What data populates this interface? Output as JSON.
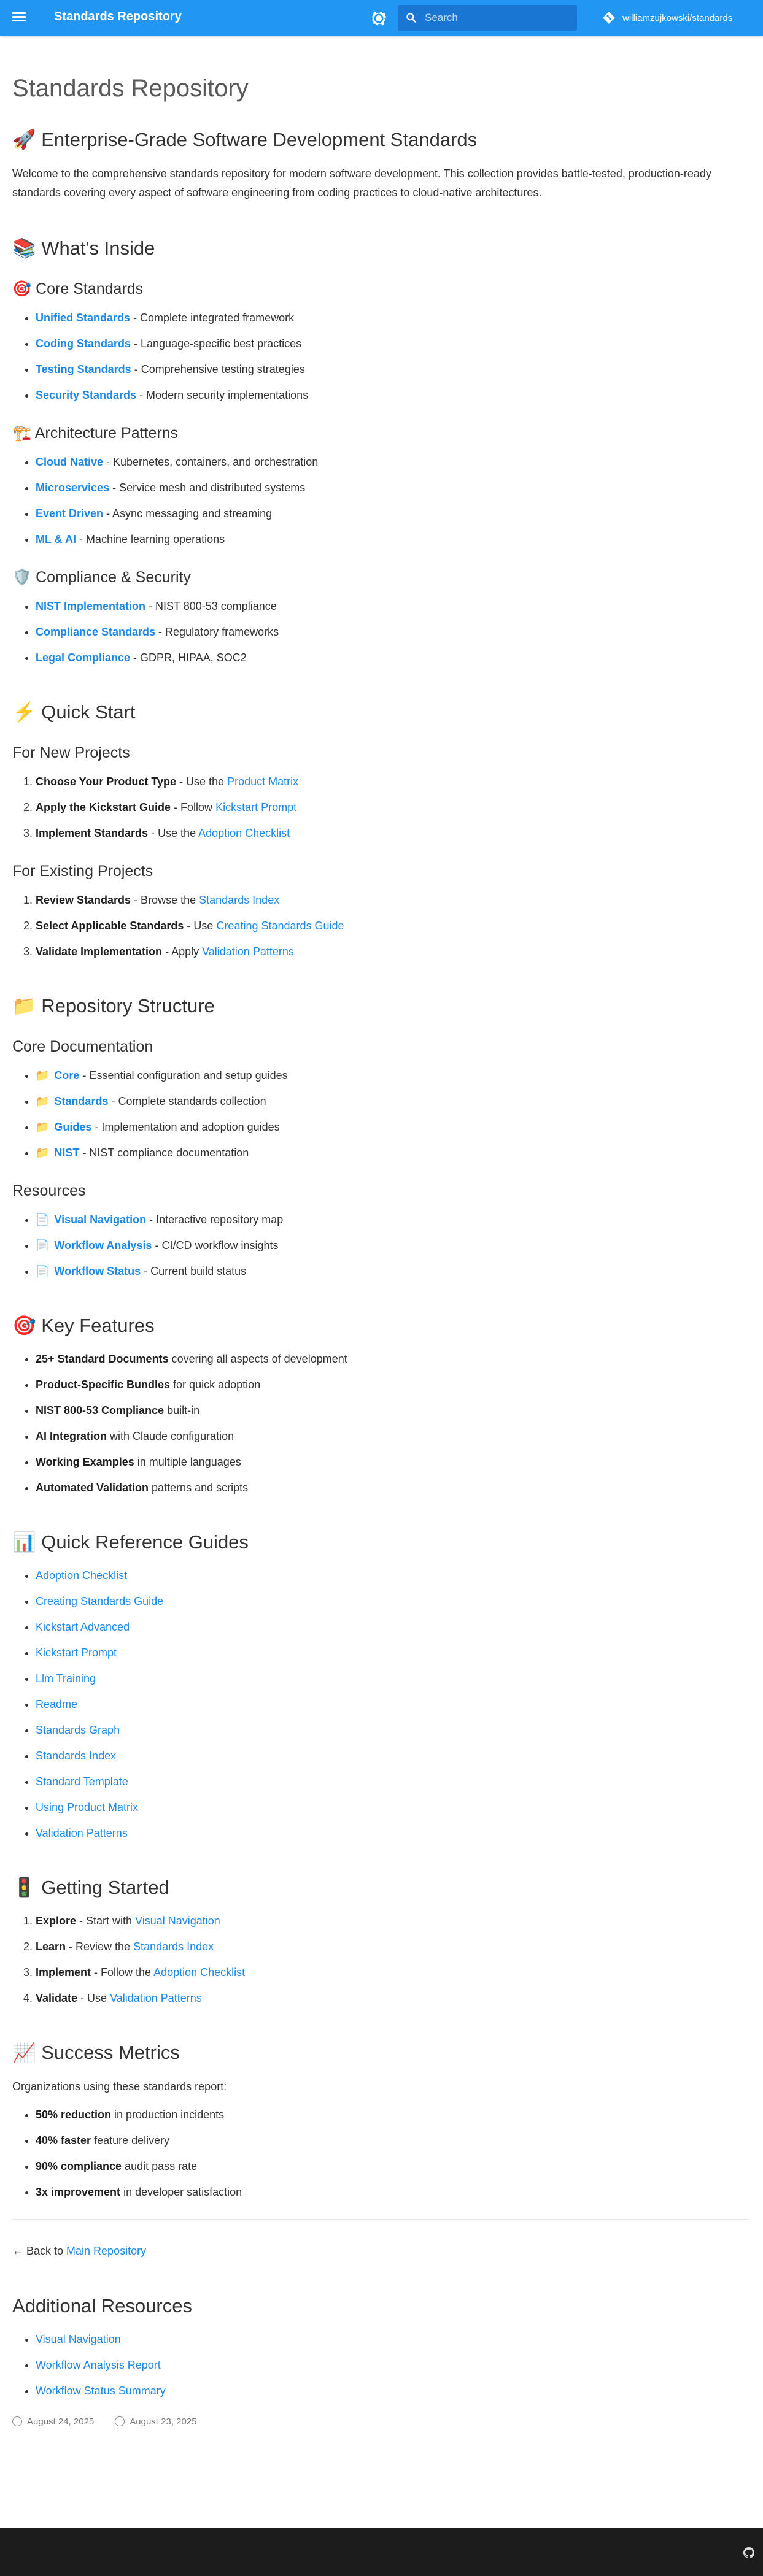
{
  "header": {
    "title": "Standards Repository",
    "search_placeholder": "Search",
    "repo": "williamzujkowski/standards",
    "accent": "#2196f3"
  },
  "page": {
    "title": "Standards Repository",
    "hero_heading": "🚀 Enterprise-Grade Software Development Standards",
    "intro": "Welcome to the comprehensive standards repository for modern software development. This collection provides battle-tested, production-ready standards covering every aspect of software engineering from coding practices to cloud-native architectures."
  },
  "whats_inside": {
    "heading": "📚 What's Inside",
    "core": {
      "heading": "🎯 Core Standards",
      "items": [
        {
          "link": "Unified Standards",
          "desc": " - Complete integrated framework"
        },
        {
          "link": "Coding Standards",
          "desc": " - Language-specific best practices"
        },
        {
          "link": "Testing Standards",
          "desc": " - Comprehensive testing strategies"
        },
        {
          "link": "Security Standards",
          "desc": " - Modern security implementations"
        }
      ]
    },
    "architecture": {
      "heading": "🏗️ Architecture Patterns",
      "items": [
        {
          "link": "Cloud Native",
          "desc": " - Kubernetes, containers, and orchestration"
        },
        {
          "link": "Microservices",
          "desc": " - Service mesh and distributed systems"
        },
        {
          "link": "Event Driven",
          "desc": " - Async messaging and streaming"
        },
        {
          "link": "ML & AI",
          "desc": " - Machine learning operations"
        }
      ]
    },
    "compliance": {
      "heading": "🛡️ Compliance & Security",
      "items": [
        {
          "link": "NIST Implementation",
          "desc": " - NIST 800-53 compliance"
        },
        {
          "link": "Compliance Standards",
          "desc": " - Regulatory frameworks"
        },
        {
          "link": "Legal Compliance",
          "desc": " - GDPR, HIPAA, SOC2"
        }
      ]
    }
  },
  "quick_start": {
    "heading": "⚡ Quick Start",
    "new": {
      "heading": "For New Projects",
      "items": [
        {
          "bold": "Choose Your Product Type",
          "text": " - Use the ",
          "link": "Product Matrix"
        },
        {
          "bold": "Apply the Kickstart Guide",
          "text": " - Follow ",
          "link": "Kickstart Prompt"
        },
        {
          "bold": "Implement Standards",
          "text": " - Use the ",
          "link": "Adoption Checklist"
        }
      ]
    },
    "existing": {
      "heading": "For Existing Projects",
      "items": [
        {
          "bold": "Review Standards",
          "text": " - Browse the ",
          "link": "Standards Index"
        },
        {
          "bold": "Select Applicable Standards",
          "text": " - Use ",
          "link": "Creating Standards Guide"
        },
        {
          "bold": "Validate Implementation",
          "text": " - Apply ",
          "link": "Validation Patterns"
        }
      ]
    }
  },
  "structure": {
    "heading": "📁 Repository Structure",
    "core_docs": {
      "heading": "Core Documentation",
      "items": [
        {
          "icon": "📁",
          "link": "Core",
          "desc": " - Essential configuration and setup guides"
        },
        {
          "icon": "📁",
          "link": "Standards",
          "desc": " - Complete standards collection"
        },
        {
          "icon": "📁",
          "link": "Guides",
          "desc": " - Implementation and adoption guides"
        },
        {
          "icon": "📁",
          "link": "NIST",
          "desc": " - NIST compliance documentation"
        }
      ]
    },
    "resources": {
      "heading": "Resources",
      "items": [
        {
          "icon": "📄",
          "link": "Visual Navigation",
          "desc": " - Interactive repository map"
        },
        {
          "icon": "📄",
          "link": "Workflow Analysis",
          "desc": " - CI/CD workflow insights"
        },
        {
          "icon": "📄",
          "link": "Workflow Status",
          "desc": " - Current build status"
        }
      ]
    }
  },
  "features": {
    "heading": "🎯 Key Features",
    "items": [
      {
        "bold": "25+ Standard Documents",
        "text": " covering all aspects of development"
      },
      {
        "bold": "Product-Specific Bundles",
        "text": " for quick adoption"
      },
      {
        "bold": "NIST 800-53 Compliance",
        "text": " built-in"
      },
      {
        "bold": "AI Integration",
        "text": " with Claude configuration"
      },
      {
        "bold": "Working Examples",
        "text": " in multiple languages"
      },
      {
        "bold": "Automated Validation",
        "text": " patterns and scripts"
      }
    ]
  },
  "quick_ref": {
    "heading": "📊 Quick Reference Guides",
    "items": [
      "Adoption Checklist",
      "Creating Standards Guide",
      "Kickstart Advanced",
      "Kickstart Prompt",
      "Llm Training",
      "Readme",
      "Standards Graph",
      "Standards Index",
      "Standard Template",
      "Using Product Matrix",
      "Validation Patterns"
    ]
  },
  "getting_started": {
    "heading": "🚦 Getting Started",
    "items": [
      {
        "bold": "Explore",
        "text": " - Start with ",
        "link": "Visual Navigation"
      },
      {
        "bold": "Learn",
        "text": " - Review the ",
        "link": "Standards Index"
      },
      {
        "bold": "Implement",
        "text": " - Follow the ",
        "link": "Adoption Checklist"
      },
      {
        "bold": "Validate",
        "text": " - Use ",
        "link": "Validation Patterns"
      }
    ]
  },
  "metrics": {
    "heading": "📈 Success Metrics",
    "intro": "Organizations using these standards report:",
    "items": [
      {
        "bold": "50% reduction",
        "text": " in production incidents"
      },
      {
        "bold": "40% faster",
        "text": " feature delivery"
      },
      {
        "bold": "90% compliance",
        "text": " audit pass rate"
      },
      {
        "bold": "3x improvement",
        "text": " in developer satisfaction"
      }
    ]
  },
  "back": {
    "prefix": "← Back to ",
    "link": "Main Repository"
  },
  "additional": {
    "heading": "Additional Resources",
    "items": [
      "Visual Navigation",
      "Workflow Analysis Report",
      "Workflow Status Summary"
    ]
  },
  "footer_meta": {
    "updated": "August 24, 2025",
    "created": "August 23, 2025"
  }
}
